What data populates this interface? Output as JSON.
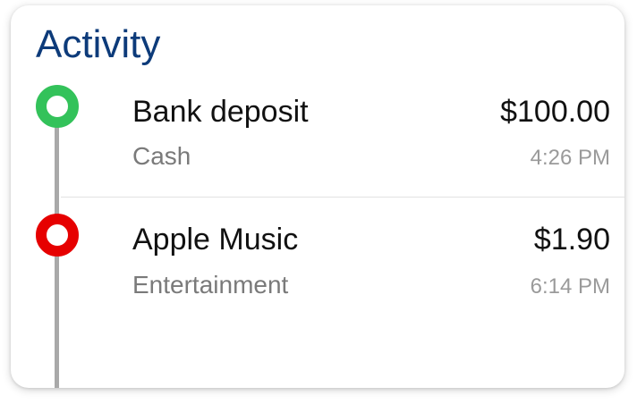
{
  "header": {
    "title": "Activity"
  },
  "colors": {
    "title": "#0d3b7a",
    "deposit_dot": "#33c25a",
    "expense_dot": "#e60000",
    "timeline": "#a9a9a9"
  },
  "activity": [
    {
      "name": "Bank deposit",
      "category": "Cash",
      "amount": "$100.00",
      "time": "4:26 PM",
      "indicator": "green-ring"
    },
    {
      "name": "Apple Music",
      "category": "Entertainment",
      "amount": "$1.90",
      "time": "6:14 PM",
      "indicator": "red-ring"
    }
  ]
}
